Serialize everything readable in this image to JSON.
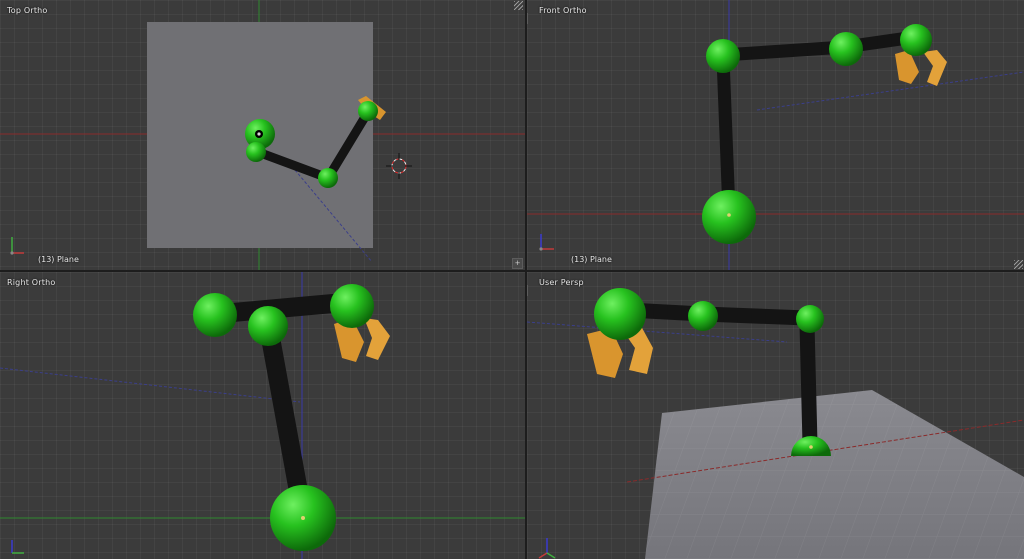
{
  "viewports": {
    "top_left": {
      "title": "Top Ortho",
      "object": "(13) Plane"
    },
    "top_right": {
      "title": "Front Ortho",
      "object": "(13) Plane"
    },
    "bottom_left": {
      "title": "Right Ortho"
    },
    "bottom_right": {
      "title": "User Persp"
    }
  },
  "widgets": {
    "plus_label": "+"
  },
  "colors": {
    "viewport_bg": "#3b3b3b",
    "joint_green": "#27c21f",
    "joint_green_dark": "#0f7a0c",
    "segment_black": "#141414",
    "gripper_orange": "#d9952e",
    "plane_grey": "#707074",
    "axis_red": "#a33030",
    "axis_green": "#3a9a3a",
    "axis_blue": "#3a3aa8"
  }
}
